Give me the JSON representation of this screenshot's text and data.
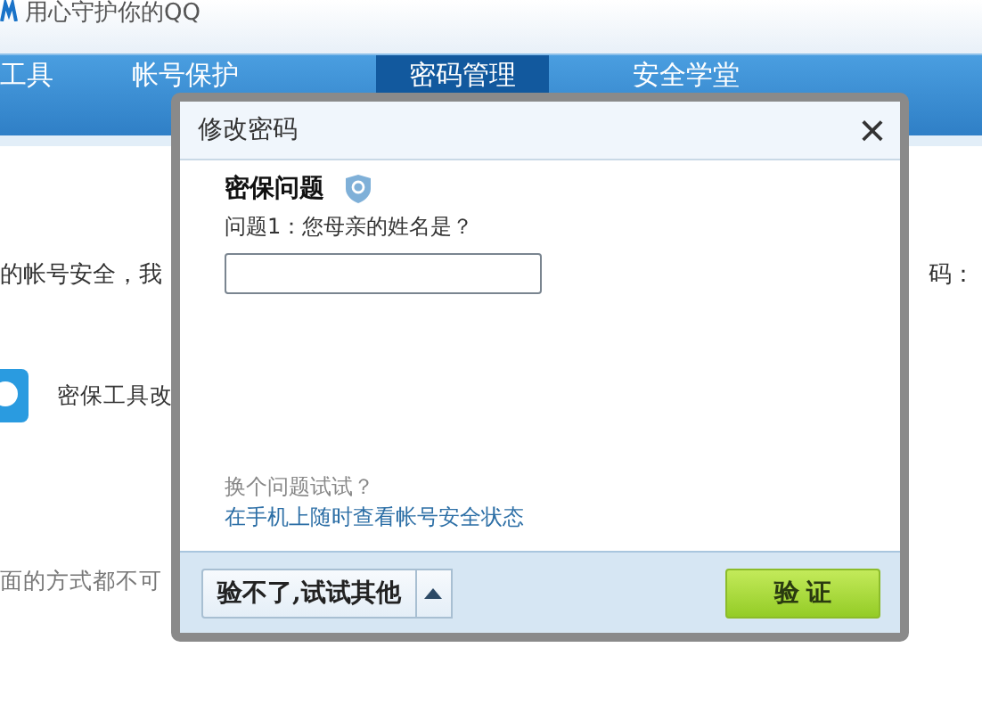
{
  "header": {
    "slogan": "用心守护你的QQ"
  },
  "nav": {
    "tabs": [
      {
        "label": "工具",
        "selected": false
      },
      {
        "label": "帐号保护",
        "selected": false
      },
      {
        "label": "密码管理",
        "selected": true
      },
      {
        "label": "安全学堂",
        "selected": false
      }
    ]
  },
  "page": {
    "intro_left": "的帐号安全，我",
    "intro_right": "码：",
    "tool_label": "密保工具改",
    "fallback_text": "面的方式都不可"
  },
  "dialog": {
    "title": "修改密码",
    "close": "×",
    "section_title": "密保问题",
    "question": "问题1：您母亲的姓名是？",
    "change_question": "换个问题试试？",
    "mobile_link": "在手机上随时查看帐号安全状态",
    "other_button": "验不了,试试其他",
    "verify_button": "验 证"
  }
}
